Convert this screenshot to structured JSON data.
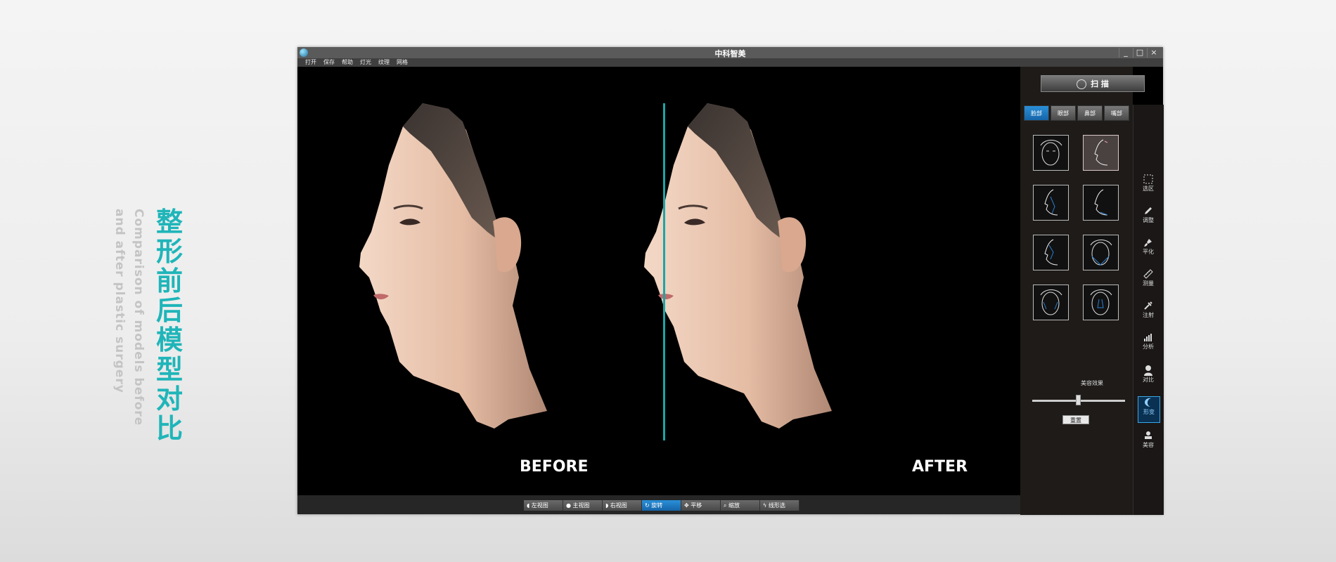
{
  "promo": {
    "title_chars": [
      "整",
      "形",
      "前",
      "后",
      "模",
      "型",
      "对",
      "比"
    ],
    "subtitle_line1": "Comparison of models before",
    "subtitle_line2": "and after plastic surgery"
  },
  "window": {
    "title": "中科智美",
    "controls": [
      "_",
      "□",
      "×"
    ]
  },
  "menu": [
    "打开",
    "保存",
    "帮助",
    "灯光",
    "纹理",
    "网格"
  ],
  "viewport": {
    "before_label": "BEFORE",
    "after_label": "AFTER",
    "divider_color": "#1aa6a8"
  },
  "bottom_toolbar": [
    {
      "icon": "face-left-icon",
      "label": "左视图"
    },
    {
      "icon": "person-icon",
      "label": "主视图"
    },
    {
      "icon": "face-right-icon",
      "label": "右视图"
    },
    {
      "icon": "rotate-icon",
      "label": "旋转",
      "active": true
    },
    {
      "icon": "move-icon",
      "label": "平移"
    },
    {
      "icon": "zoom-icon",
      "label": "缩放"
    },
    {
      "icon": "lasso-icon",
      "label": "线形选"
    }
  ],
  "right_panel": {
    "scan_label": "扫 描",
    "feature_tabs": [
      {
        "label": "脸部",
        "active": true
      },
      {
        "label": "眼部"
      },
      {
        "label": "鼻部"
      },
      {
        "label": "嘴部"
      }
    ],
    "presets": [
      "face-front-icon",
      "face-profile-selected-icon",
      "face-profile-nose-icon",
      "face-profile-chin-icon",
      "face-profile-lip-icon",
      "face-front-jaw-icon",
      "face-front-cheek-icon",
      "face-front-nose-icon"
    ],
    "slider_label": "美容效果",
    "slider_value": 0.5,
    "reset_label": "重置"
  },
  "right_toolbar": [
    {
      "icon": "select-area-icon",
      "label": "选区"
    },
    {
      "icon": "pencil-icon",
      "label": "调整"
    },
    {
      "icon": "brush-icon",
      "label": "平化"
    },
    {
      "icon": "ruler-icon",
      "label": "测量"
    },
    {
      "icon": "syringe-icon",
      "label": "注射"
    },
    {
      "icon": "bar-chart-icon",
      "label": "分析"
    },
    {
      "icon": "compare-icon",
      "label": "对比"
    },
    {
      "icon": "moon-icon",
      "label": "形变",
      "active": true
    },
    {
      "icon": "stamp-icon",
      "label": "美容"
    }
  ],
  "colors": {
    "accent": "#1fb5b9",
    "active_blue": "#1b78c4",
    "window_bg": "#000000",
    "panel_bg": "#1e1b19"
  }
}
